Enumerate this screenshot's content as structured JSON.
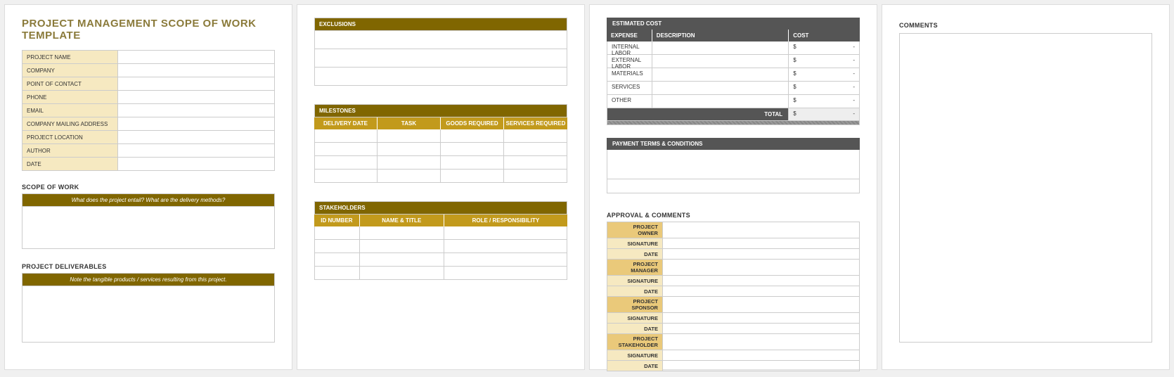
{
  "title": "PROJECT MANAGEMENT SCOPE OF WORK TEMPLATE",
  "info_rows": [
    "PROJECT NAME",
    "COMPANY",
    "POINT OF CONTACT",
    "PHONE",
    "EMAIL",
    "COMPANY MAILING ADDRESS",
    "PROJECT LOCATION",
    "AUTHOR",
    "DATE"
  ],
  "scope": {
    "label": "SCOPE OF WORK",
    "hint": "What does the project entail? What are the delivery methods?"
  },
  "deliverables": {
    "label": "PROJECT DELIVERABLES",
    "hint": "Note the tangible products / services resulting from this project."
  },
  "exclusions": {
    "label": "EXCLUSIONS"
  },
  "milestones": {
    "label": "MILESTONES",
    "cols": [
      "DELIVERY DATE",
      "TASK",
      "GOODS REQUIRED",
      "SERVICES REQUIRED"
    ]
  },
  "stakeholders": {
    "label": "STAKEHOLDERS",
    "cols": [
      "ID NUMBER",
      "NAME & TITLE",
      "ROLE / RESPONSIBILITY"
    ]
  },
  "cost": {
    "label": "ESTIMATED COST",
    "cols": [
      "EXPENSE",
      "DESCRIPTION",
      "COST"
    ],
    "rows": [
      "INTERNAL LABOR",
      "EXTERNAL LABOR",
      "MATERIALS",
      "SERVICES",
      "OTHER"
    ],
    "currency": "$",
    "dash": "-",
    "total_label": "TOTAL"
  },
  "payment": {
    "label": "PAYMENT TERMS & CONDITIONS"
  },
  "approval": {
    "label": "APPROVAL & COMMENTS",
    "groups": [
      {
        "head": "PROJECT OWNER",
        "sig": "SIGNATURE",
        "date": "DATE"
      },
      {
        "head": "PROJECT MANAGER",
        "sig": "SIGNATURE",
        "date": "DATE"
      },
      {
        "head": "PROJECT SPONSOR",
        "sig": "SIGNATURE",
        "date": "DATE"
      },
      {
        "head": "PROJECT STAKEHOLDER",
        "sig": "SIGNATURE",
        "date": "DATE"
      }
    ]
  },
  "comments": {
    "label": "COMMENTS"
  }
}
